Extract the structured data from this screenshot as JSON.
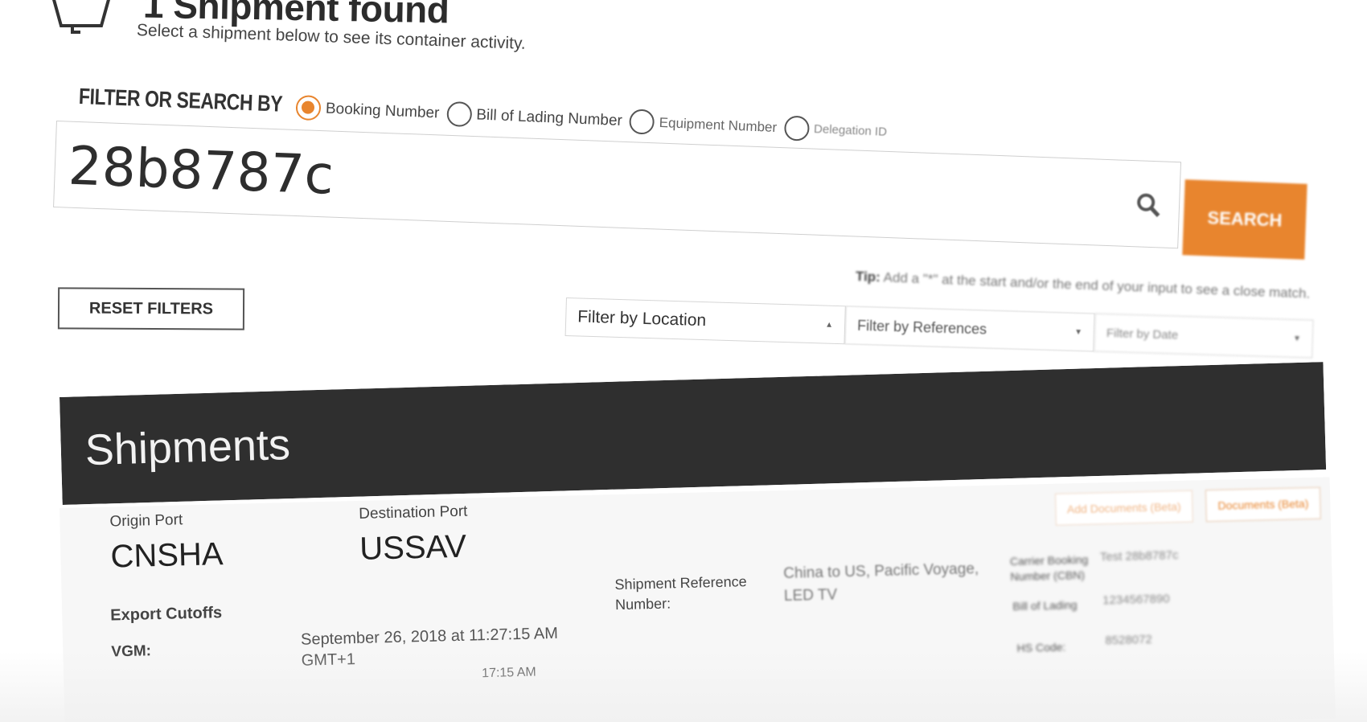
{
  "header": {
    "title": "1 Shipment found",
    "subtitle": "Select a shipment below to see its container activity."
  },
  "filter": {
    "label": "FILTER OR SEARCH BY",
    "options": [
      {
        "label": "Booking Number",
        "selected": true
      },
      {
        "label": "Bill of Lading Number",
        "selected": false
      },
      {
        "label": "Equipment Number",
        "selected": false
      },
      {
        "label": "Delegation ID",
        "selected": false
      }
    ],
    "search_value": "28b8787c",
    "search_button": "SEARCH",
    "tip_bold": "Tip:",
    "tip_text": "Add a \"*\" at the start and/or the end of your input to see a close match.",
    "reset_button": "RESET FILTERS",
    "location_select": "Filter by Location",
    "references_select": "Filter by References",
    "date_select": "Filter by Date"
  },
  "shipments": {
    "heading": "Shipments",
    "add_documents_button": "Add Documents (Beta)",
    "documents_button": "Documents (Beta)",
    "origin_label": "Origin Port",
    "origin_value": "CNSHA",
    "destination_label": "Destination Port",
    "destination_value": "USSAV",
    "export_cutoffs_label": "Export Cutoffs",
    "vgm_label": "VGM:",
    "vgm_value": "September 26, 2018 at 11:27:15 AM GMT+1",
    "next_cutoff_value": "17:15 AM",
    "shipment_ref_label": "Shipment Reference Number:",
    "shipment_ref_value": "China to US, Pacific Voyage, LED TV",
    "carrier_booking_label": "Carrier Booking Number (CBN)",
    "carrier_booking_value": "Test 28b8787c",
    "bill_of_lading_label": "Bill of Lading",
    "bill_of_lading_value": "1234567890",
    "hs_code_label": "HS Code:",
    "hs_code_value": "8528072"
  },
  "colors": {
    "accent": "#e8852e",
    "dark_bar": "#2f2f2f"
  }
}
